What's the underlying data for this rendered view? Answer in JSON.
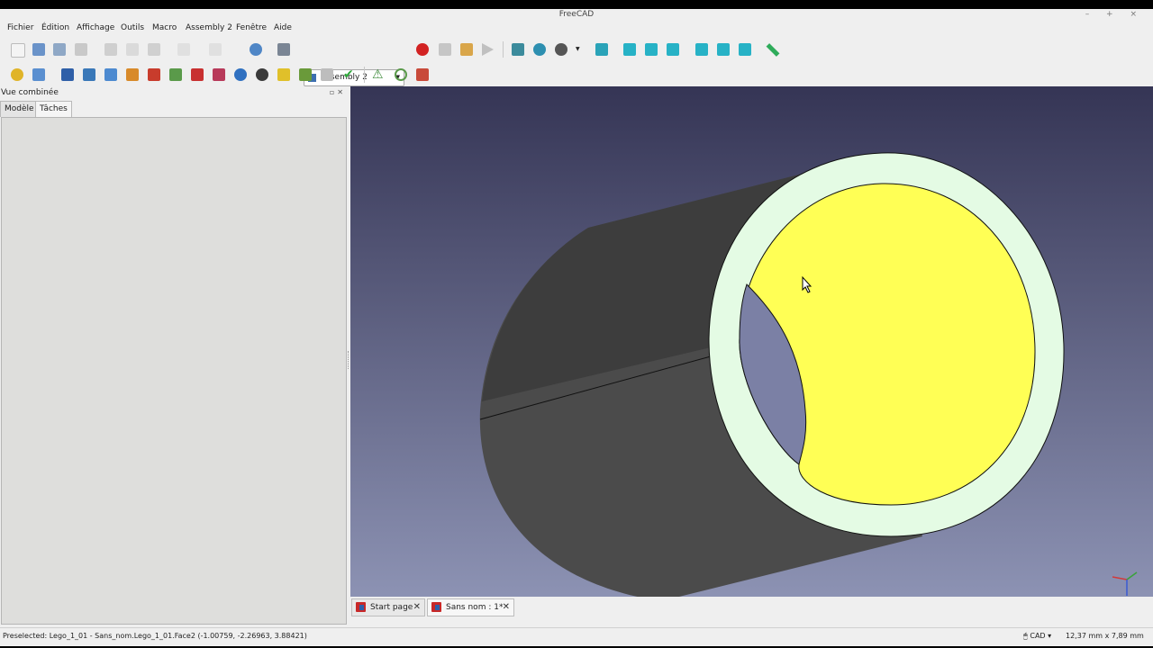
{
  "window": {
    "title": "FreeCAD",
    "controls": [
      "–",
      "+",
      "×"
    ]
  },
  "menu": [
    "Fichier",
    "Édition",
    "Affichage",
    "Outils",
    "Macro",
    "Assembly 2",
    "Fenêtre",
    "Aide"
  ],
  "toolbar": {
    "workbench_selector": "Assembly 2",
    "icons_row1": [
      "new-file-icon",
      "open-file-icon",
      "save-icon",
      "save-as-icon",
      "cut-icon",
      "copy-icon",
      "paste-icon",
      "undo-icon",
      "redo-icon",
      "refresh-icon",
      "whats-this-icon",
      "macro-record-icon",
      "macro-stop-icon",
      "macro-edit-icon",
      "macro-run-icon",
      "fit-all-icon",
      "fit-selection-icon",
      "draw-style-icon",
      "isometric-view-icon",
      "front-view-icon",
      "top-view-icon",
      "right-view-icon",
      "rear-view-icon",
      "bottom-view-icon",
      "left-view-icon",
      "measure-icon"
    ],
    "icons_row2": [
      "assembly-new-icon",
      "assembly-open-icon",
      "import-part-icon",
      "update-parts-icon",
      "move-part-icon",
      "mirror-icon",
      "constraint-1-icon",
      "constraint-2-icon",
      "constraint-3-icon",
      "constraint-4-icon",
      "solve-icon",
      "animate-icon",
      "bom-icon",
      "part-info-icon",
      "list-icon",
      "check-icon",
      "warning-icon",
      "degrees-of-freedom-icon",
      "clear-icon"
    ]
  },
  "left_panel": {
    "title": "Vue combinée",
    "tabs": [
      "Modèle",
      "Tâches"
    ],
    "active_tab": "Tâches"
  },
  "doc_tabs": [
    {
      "label": "Start page"
    },
    {
      "label": "Sans nom : 1*",
      "active": true
    }
  ],
  "status": {
    "preselection": "Preselected: Lego_1_01 - Sans_nom.Lego_1_01.Face2 (-1.00759, -2.26963, 3.88421)",
    "navigation_style": "CAD",
    "dimensions": "12,37 mm x 7,89 mm"
  },
  "colors": {
    "face_highlight": "#ffff55",
    "face_rim": "#e4fbe4",
    "body": "#4a4a4a",
    "bg_top": "#353555",
    "bg_bottom": "#8e94b5"
  }
}
